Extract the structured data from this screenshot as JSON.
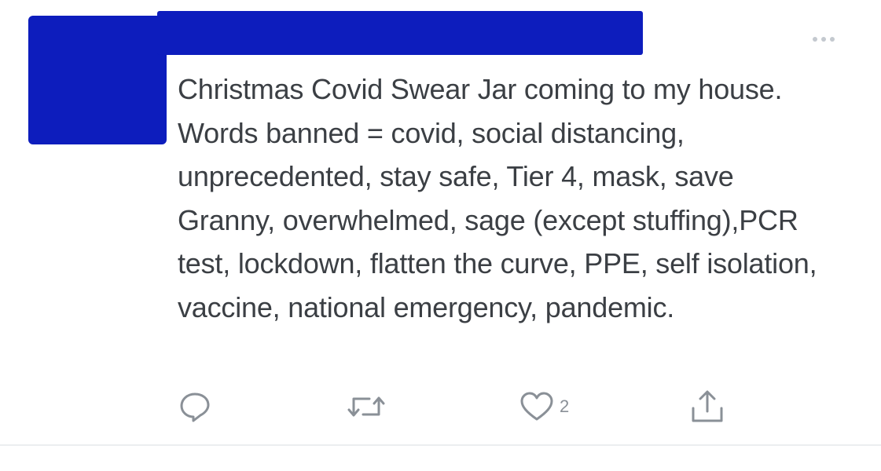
{
  "tweet": {
    "text": "Christmas Covid Swear Jar coming to my house. Words banned = covid, social distancing, unprecedented, stay safe, Tier 4, mask, save Granny, overwhelmed, sage (except stuffing),PCR test, lockdown, flatten the curve, PPE, self isolation, vaccine, national emergency, pandemic.",
    "like_count": "2"
  },
  "icons": {
    "more": "more-horizontal-icon",
    "reply": "reply-icon",
    "retweet": "retweet-icon",
    "like": "heart-icon",
    "share": "share-icon"
  },
  "colors": {
    "redaction": "#0d1dbd",
    "text": "#3b3f44",
    "icon": "#8a9097"
  }
}
